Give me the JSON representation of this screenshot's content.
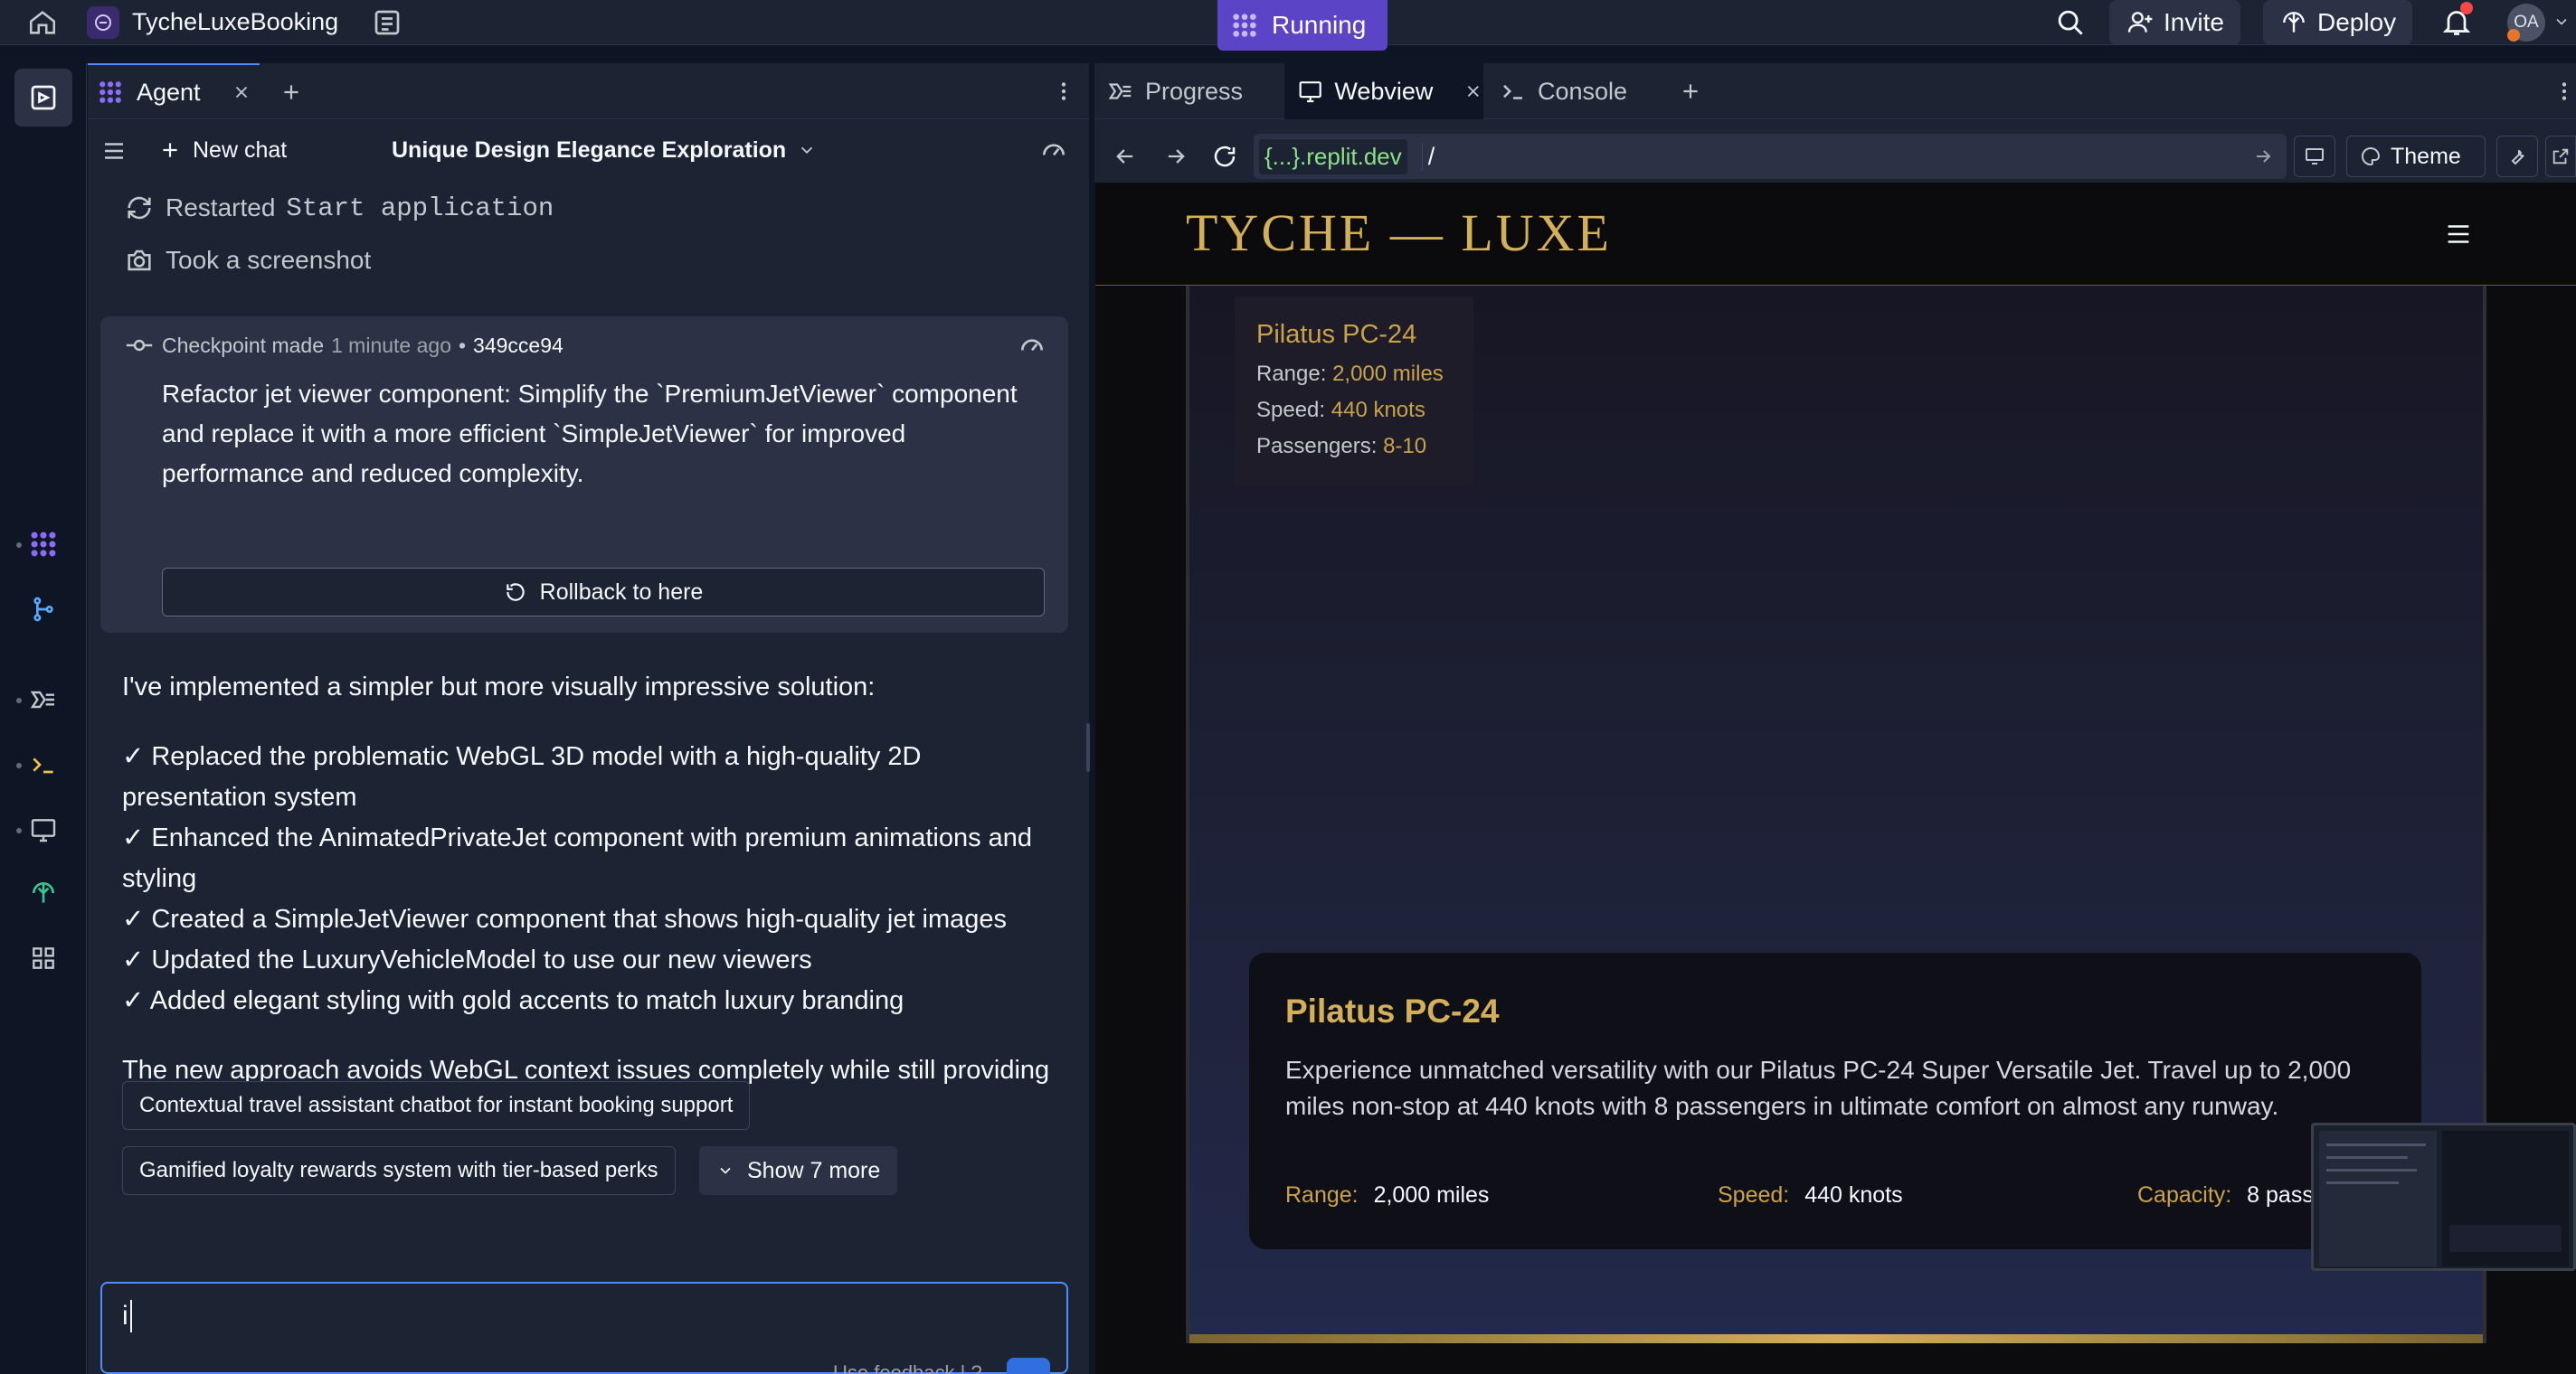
{
  "topbar": {
    "app_name": "TycheLuxeBooking",
    "run_status": "Running",
    "invite_label": "Invite",
    "deploy_label": "Deploy",
    "avatar_initials": "OA"
  },
  "agent": {
    "tab_label": "Agent",
    "new_chat_label": "New chat",
    "chat_title": "Unique Design Elegance Exploration",
    "activity": [
      {
        "label": "Restarted",
        "code": "Start application"
      },
      {
        "label": "Took a screenshot",
        "code": ""
      }
    ],
    "checkpoint": {
      "label": "Checkpoint made",
      "time": "1 minute ago",
      "separator": "•",
      "hash": "349cce94",
      "description": "Refactor jet viewer component: Simplify the `PremiumJetViewer` component and replace it with a more efficient `SimpleJetViewer` for improved performance and reduced complexity.",
      "rollback_label": "Rollback to here"
    },
    "message_intro": "I've implemented a simpler but more visually impressive solution:",
    "message_items": [
      "✓ Replaced the problematic WebGL 3D model with a high-quality 2D presentation system",
      "✓ Enhanced the AnimatedPrivateJet component with premium animations and styling",
      "✓ Created a SimpleJetViewer component that shows high-quality jet images",
      "✓ Updated the LuxuryVehicleModel to use our new viewers",
      "✓ Added elegant styling with gold accents to match luxury branding"
    ],
    "message_outro": "The new approach avoids WebGL context issues completely while still providing a premium visual experience. How does it look now?",
    "suggestions": [
      "Contextual travel assistant chatbot for instant booking support",
      "Gamified loyalty rewards system with tier-based perks"
    ],
    "show_more_label": "Show 7 more",
    "input_value": "i",
    "input_footer": "Use feedback | ?"
  },
  "right": {
    "tabs": [
      "Progress",
      "Webview",
      "Console"
    ],
    "url_domain": "{...}.replit.dev",
    "url_path": "/",
    "theme_label": "Theme"
  },
  "site": {
    "logo": "TYCHE — LUXE",
    "mini_card": {
      "title": "Pilatus PC-24",
      "range_label": "Range:",
      "range_value": "2,000 miles",
      "speed_label": "Speed:",
      "speed_value": "440 knots",
      "passengers_label": "Passengers:",
      "passengers_value": "8-10"
    },
    "info_card": {
      "title": "Pilatus PC-24",
      "description": "Experience unmatched versatility with our Pilatus PC-24 Super Versatile Jet. Travel up to 2,000 miles non-stop at 440 knots with 8 passengers in ultimate comfort on almost any runway.",
      "range_label": "Range:",
      "range_value": "2,000 miles",
      "speed_label": "Speed:",
      "speed_value": "440 knots",
      "capacity_label": "Capacity:",
      "capacity_value": "8 pass"
    }
  },
  "colors": {
    "accent_gold": "#c9a24a",
    "running_bg": "#5b44c6",
    "link_green": "#8ee089",
    "bg_dark": "#0e1525",
    "panel": "#1c2333"
  }
}
